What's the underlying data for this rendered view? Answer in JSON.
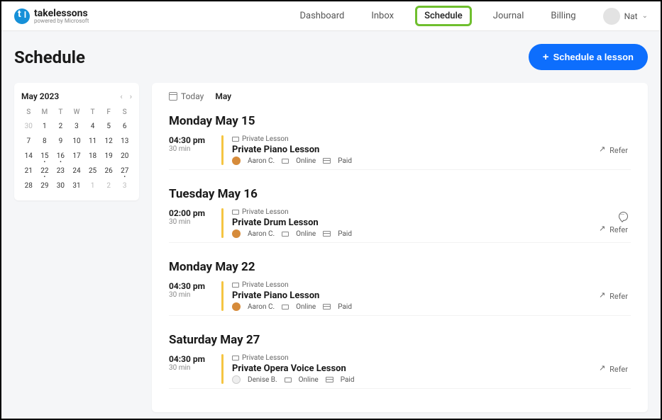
{
  "brand": {
    "name": "takelessons",
    "sub": "powered by Microsoft"
  },
  "nav": {
    "items": [
      {
        "label": "Dashboard"
      },
      {
        "label": "Inbox"
      },
      {
        "label": "Schedule",
        "active": true
      },
      {
        "label": "Journal"
      },
      {
        "label": "Billing"
      }
    ]
  },
  "user": {
    "name": "Nat"
  },
  "page_title": "Schedule",
  "schedule_button": "Schedule a lesson",
  "calendar": {
    "title": "May 2023",
    "dow": [
      "S",
      "M",
      "T",
      "W",
      "T",
      "F",
      "S"
    ],
    "days": [
      {
        "n": "30",
        "muted": true
      },
      {
        "n": "1"
      },
      {
        "n": "2"
      },
      {
        "n": "3"
      },
      {
        "n": "4"
      },
      {
        "n": "5"
      },
      {
        "n": "6"
      },
      {
        "n": "7"
      },
      {
        "n": "8"
      },
      {
        "n": "9"
      },
      {
        "n": "10"
      },
      {
        "n": "11"
      },
      {
        "n": "12"
      },
      {
        "n": "13"
      },
      {
        "n": "14"
      },
      {
        "n": "15",
        "dot": true
      },
      {
        "n": "16",
        "dot": true
      },
      {
        "n": "17"
      },
      {
        "n": "18"
      },
      {
        "n": "19"
      },
      {
        "n": "20"
      },
      {
        "n": "21"
      },
      {
        "n": "22",
        "dot": true
      },
      {
        "n": "23"
      },
      {
        "n": "24"
      },
      {
        "n": "25"
      },
      {
        "n": "26"
      },
      {
        "n": "27",
        "dot": true
      },
      {
        "n": "28"
      },
      {
        "n": "29"
      },
      {
        "n": "30"
      },
      {
        "n": "31"
      },
      {
        "n": "1",
        "muted": true
      },
      {
        "n": "2",
        "muted": true
      },
      {
        "n": "3",
        "muted": true
      }
    ]
  },
  "main": {
    "today_label": "Today",
    "month_label": "May",
    "refer_label": "Refer",
    "online_label": "Online",
    "paid_label": "Paid",
    "tag_label": "Private Lesson",
    "groups": [
      {
        "heading": "Monday May 15",
        "lessons": [
          {
            "time": "04:30 pm",
            "duration": "30 min",
            "title": "Private Piano Lesson",
            "teacher": "Aaron C.",
            "chat": false,
            "avatar_empty": false
          }
        ]
      },
      {
        "heading": "Tuesday May 16",
        "lessons": [
          {
            "time": "02:00 pm",
            "duration": "30 min",
            "title": "Private Drum Lesson",
            "teacher": "Aaron C.",
            "chat": true,
            "avatar_empty": false
          }
        ]
      },
      {
        "heading": "Monday May 22",
        "lessons": [
          {
            "time": "04:30 pm",
            "duration": "30 min",
            "title": "Private Piano Lesson",
            "teacher": "Aaron C.",
            "chat": false,
            "avatar_empty": false
          }
        ]
      },
      {
        "heading": "Saturday May 27",
        "lessons": [
          {
            "time": "04:30 pm",
            "duration": "30 min",
            "title": "Private Opera Voice Lesson",
            "teacher": "Denise B.",
            "chat": false,
            "avatar_empty": true
          }
        ]
      }
    ]
  }
}
